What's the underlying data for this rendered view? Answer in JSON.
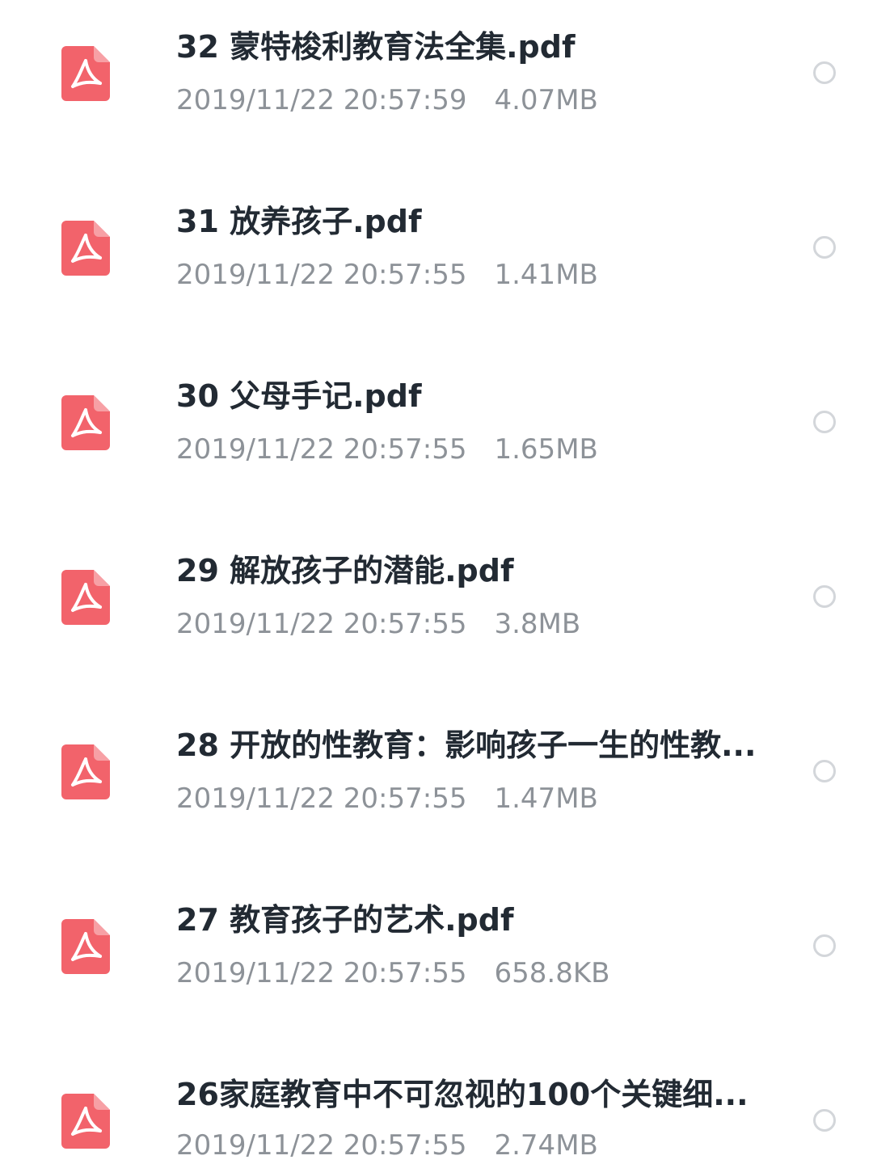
{
  "files": [
    {
      "name": "32 蒙特梭利教育法全集.pdf",
      "date": "2019/11/22 20:57:59",
      "size": "4.07MB",
      "icon": "pdf-file-icon"
    },
    {
      "name": "31 放养孩子.pdf",
      "date": "2019/11/22 20:57:55",
      "size": "1.41MB",
      "icon": "pdf-file-icon"
    },
    {
      "name": "30 父母手记.pdf",
      "date": "2019/11/22 20:57:55",
      "size": "1.65MB",
      "icon": "pdf-file-icon"
    },
    {
      "name": "29 解放孩子的潜能.pdf",
      "date": "2019/11/22 20:57:55",
      "size": "3.8MB",
      "icon": "pdf-file-icon"
    },
    {
      "name": "28 开放的性教育：影响孩子一生的性教...",
      "date": "2019/11/22 20:57:55",
      "size": "1.47MB",
      "icon": "pdf-file-icon"
    },
    {
      "name": "27 教育孩子的艺术.pdf",
      "date": "2019/11/22 20:57:55",
      "size": "658.8KB",
      "icon": "pdf-file-icon"
    },
    {
      "name": "26家庭教育中不可忽视的100个关键细...",
      "date": "2019/11/22 20:57:55",
      "size": "2.74MB",
      "icon": "pdf-file-icon"
    }
  ],
  "colors": {
    "pdf_icon": "#f2636b",
    "title": "#222a33",
    "meta": "#8d9298",
    "radio_border": "#d3d6da"
  }
}
